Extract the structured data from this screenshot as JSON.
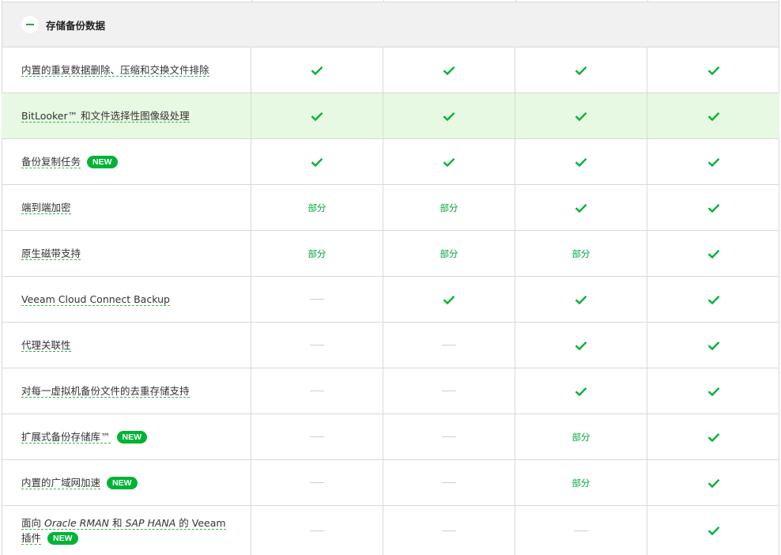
{
  "section": {
    "title": "存储备份数据",
    "collapse_icon": "minus-icon"
  },
  "colors": {
    "accent": "#00b336",
    "highlight_row": "#e7f9e2",
    "header_bg": "#f1f1f1",
    "partial_text": "#00a63e"
  },
  "labels": {
    "badge_new": "NEW",
    "partial": "部分"
  },
  "rows": [
    {
      "feature": "内置的重复数据删除、压缩和交换文件排除",
      "values": [
        "check",
        "check",
        "check",
        "check"
      ]
    },
    {
      "feature": "BitLooker™ 和文件选择性图像级处理",
      "values": [
        "check",
        "check",
        "check",
        "check"
      ],
      "highlighted": true
    },
    {
      "feature": "备份复制任务",
      "new": true,
      "values": [
        "check",
        "check",
        "check",
        "check"
      ]
    },
    {
      "feature": "端到端加密",
      "values": [
        "partial",
        "partial",
        "check",
        "check"
      ]
    },
    {
      "feature": "原生磁带支持",
      "values": [
        "partial",
        "partial",
        "partial",
        "check"
      ]
    },
    {
      "feature": "Veeam Cloud Connect Backup",
      "values": [
        "none",
        "check",
        "check",
        "check"
      ]
    },
    {
      "feature": "代理关联性",
      "values": [
        "none",
        "none",
        "check",
        "check"
      ]
    },
    {
      "feature": "对每一虚拟机备份文件的去重存储支持",
      "values": [
        "none",
        "none",
        "check",
        "check"
      ]
    },
    {
      "feature": "扩展式备份存储库™",
      "new": true,
      "values": [
        "none",
        "none",
        "partial",
        "check"
      ]
    },
    {
      "feature": "内置的广域网加速",
      "new": true,
      "values": [
        "none",
        "none",
        "partial",
        "check"
      ]
    },
    {
      "feature_parts": {
        "p1": "面向 ",
        "p2": "Oracle RMAN",
        "p3": " 和 ",
        "p4": "SAP HANA",
        "p5": " 的 Veeam 插件"
      },
      "new": true,
      "values": [
        "none",
        "none",
        "none",
        "check"
      ]
    }
  ]
}
